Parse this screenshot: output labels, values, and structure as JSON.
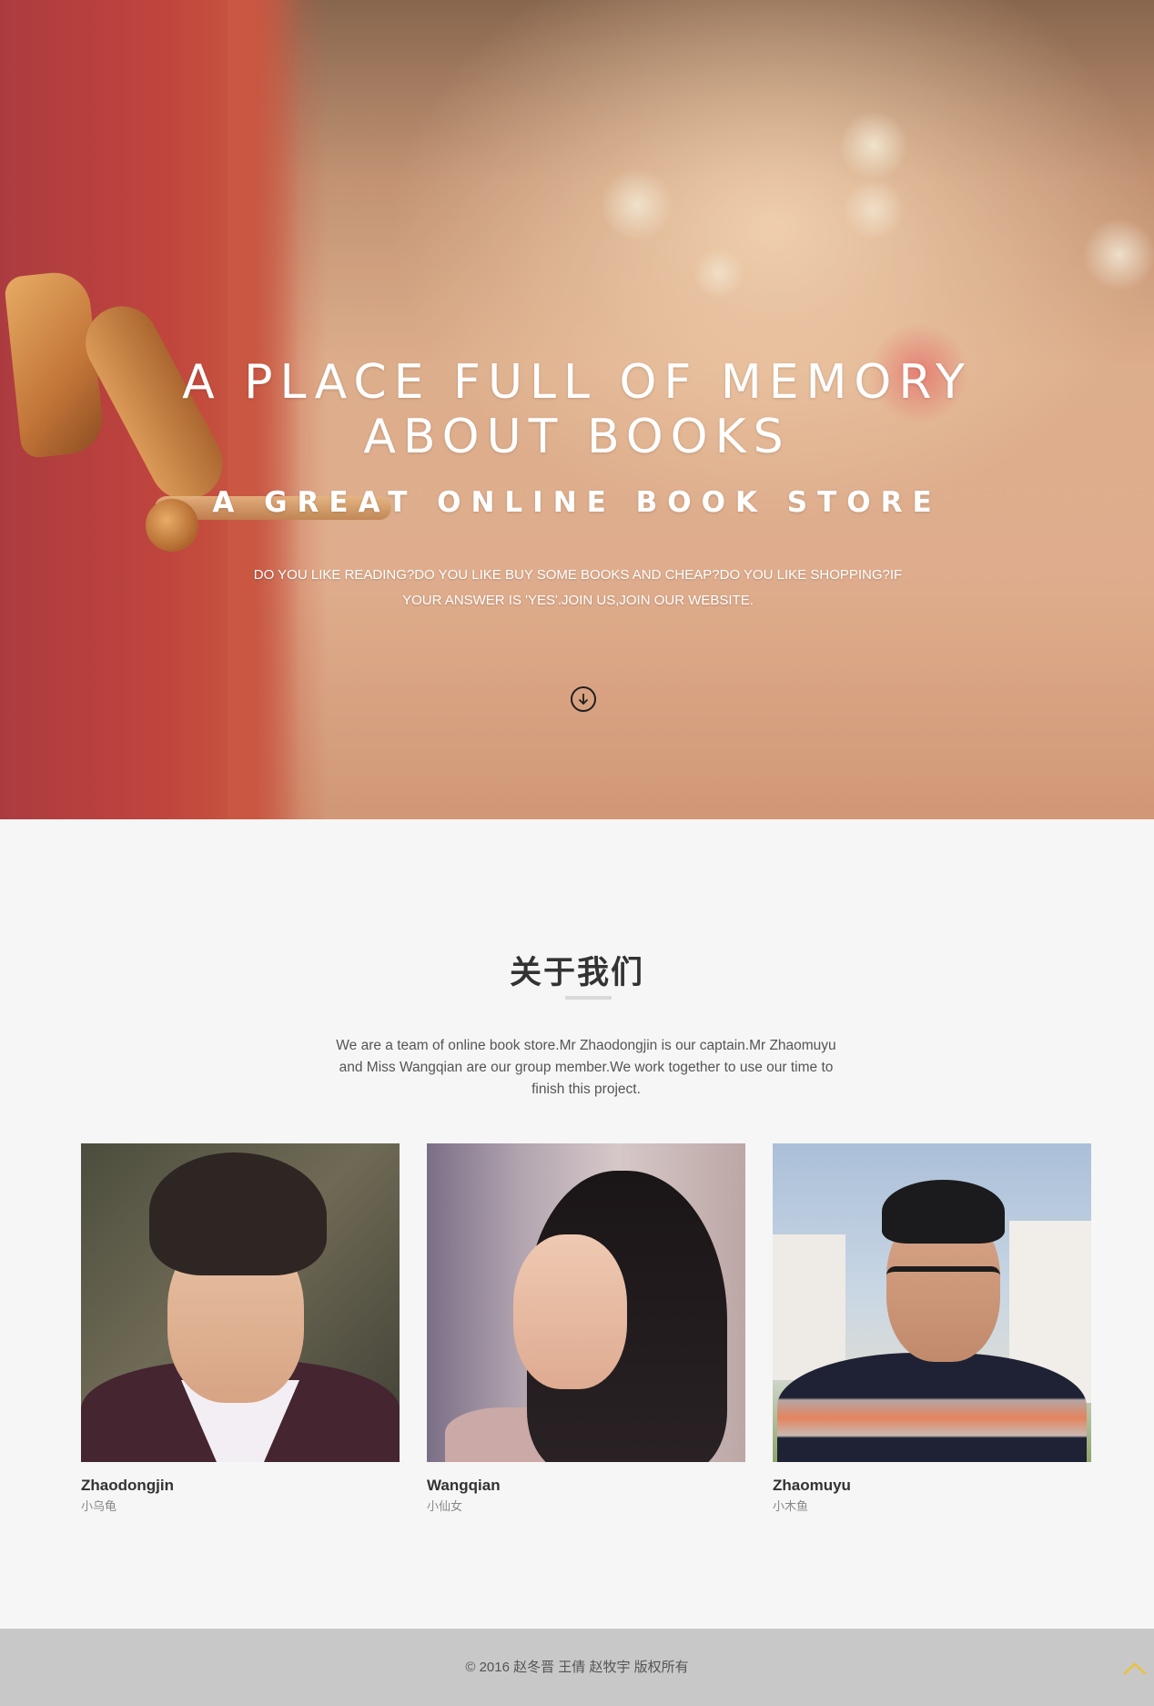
{
  "hero": {
    "title_line1": "A PLACE FULL OF MEMORY",
    "title_line2": "ABOUT BOOKS",
    "subtitle": "A GREAT ONLINE BOOK STORE",
    "text_line1": "DO YOU LIKE READING?DO YOU LIKE BUY SOME BOOKS AND CHEAP?DO YOU LIKE SHOPPING?IF",
    "text_line2": "YOUR ANSWER IS 'YES'.JOIN US,JOIN OUR WEBSITE.",
    "scroll_icon": "arrow-down-circle-icon"
  },
  "about": {
    "title": "关于我们",
    "text_line1": "We are a team of online book store.Mr Zhaodongjin is our captain.Mr Zhaomuyu",
    "text_line2": "and Miss Wangqian are our group member.We work together to use our time to",
    "text_line3": "finish this project."
  },
  "team": [
    {
      "name": "Zhaodongjin",
      "nickname": "小乌龟"
    },
    {
      "name": "Wangqian",
      "nickname": "小仙女"
    },
    {
      "name": "Zhaomuyu",
      "nickname": "小木鱼"
    }
  ],
  "footer": {
    "copyright": "© 2016 赵冬晋 王倩 赵牧宇 版权所有",
    "back_to_top_icon": "chevron-up-icon",
    "accent_color": "#e8c33a"
  }
}
